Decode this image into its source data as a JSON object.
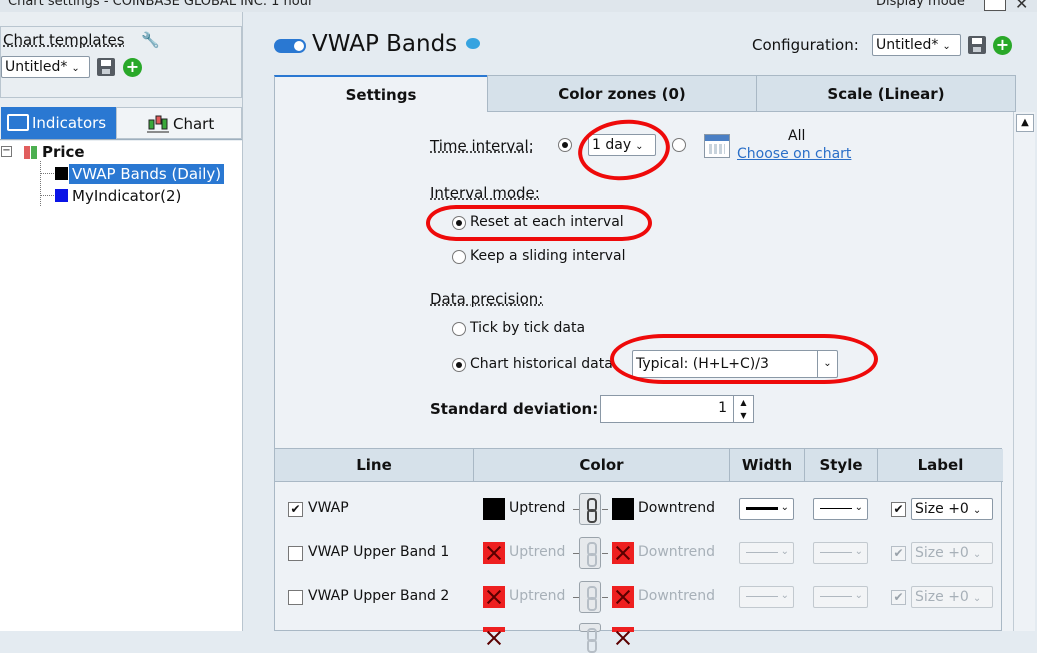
{
  "titlebar": {
    "title": "Chart settings - COINBASE GLOBAL INC. 1 hour",
    "display_mode": "Display mode"
  },
  "left": {
    "templates_label": "Chart templates",
    "template_value": "Untitled*",
    "tabs": {
      "indicators": "Indicators",
      "chart": "Chart"
    },
    "tree": {
      "root": "Price",
      "items": [
        "VWAP Bands (Daily)",
        "MyIndicator(2)"
      ]
    }
  },
  "header": {
    "title": "VWAP Bands",
    "config_label": "Configuration:",
    "config_value": "Untitled*"
  },
  "tabs": [
    "Settings",
    "Color zones (0)",
    "Scale (Linear)"
  ],
  "settings": {
    "time_interval_label": "Time interval:",
    "time_interval_value": "1 day",
    "all_label": "All",
    "choose_on_chart": "Choose on chart",
    "interval_mode_label": "Interval mode:",
    "interval_mode_options": [
      "Reset at each interval",
      "Keep a sliding interval"
    ],
    "data_precision_label": "Data precision:",
    "data_precision_options": [
      "Tick by tick data",
      "Chart historical data"
    ],
    "price_source": "Typical: (H+L+C)/3",
    "std_dev_label": "Standard deviation:",
    "std_dev_value": "1"
  },
  "table": {
    "headers": [
      "Line",
      "Color",
      "Width",
      "Style",
      "Label"
    ],
    "rows": [
      {
        "name": "VWAP",
        "checked": true,
        "up": "Uptrend",
        "down": "Downtrend",
        "label": "Size +0"
      },
      {
        "name": "VWAP Upper Band 1",
        "checked": false,
        "up": "Uptrend",
        "down": "Downtrend",
        "label": "Size +0"
      },
      {
        "name": "VWAP Upper Band 2",
        "checked": false,
        "up": "Uptrend",
        "down": "Downtrend",
        "label": "Size +0"
      }
    ]
  },
  "colors": {
    "accent": "#2a78d2",
    "annotation": "#ee0a0a"
  }
}
